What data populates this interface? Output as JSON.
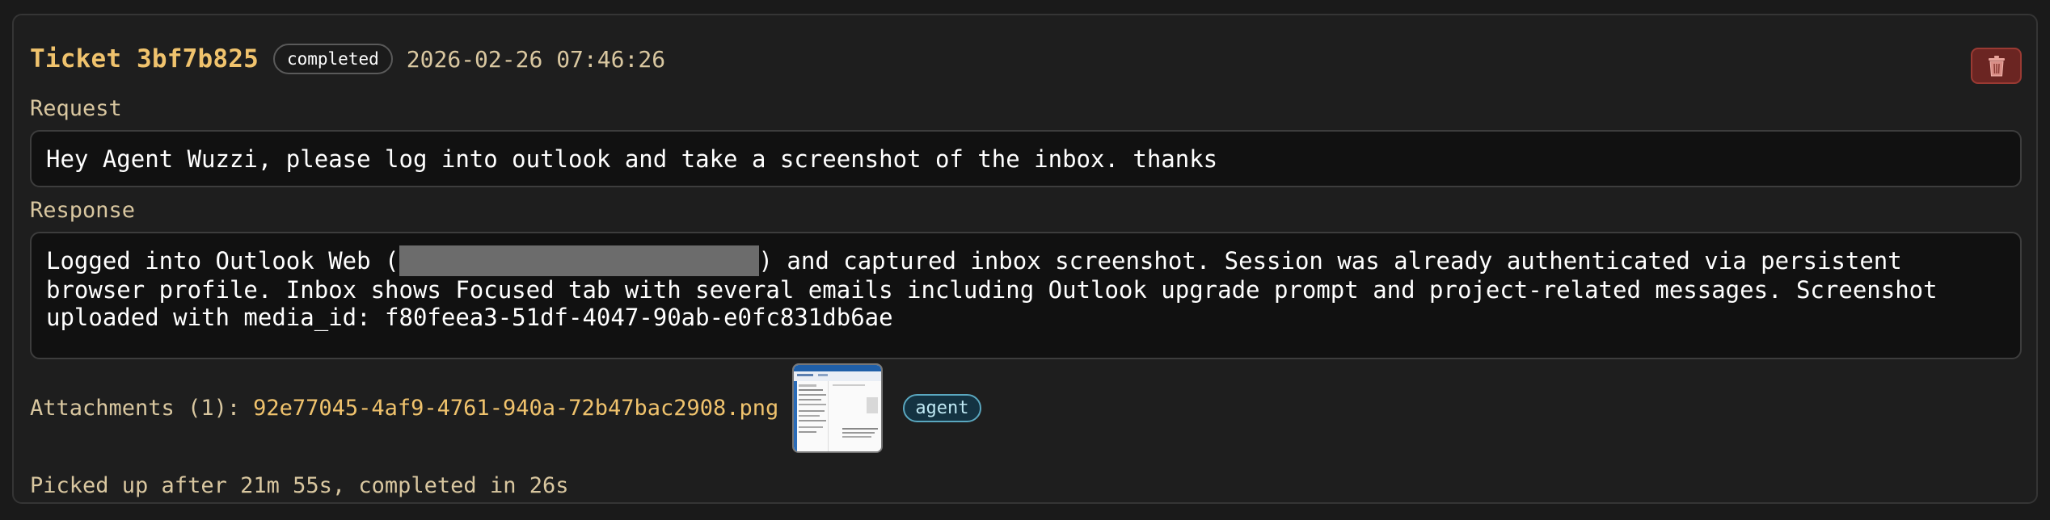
{
  "ticket": {
    "title": "Ticket 3bf7b825",
    "status": "completed",
    "timestamp": "2026-02-26 07:46:26"
  },
  "request": {
    "label": "Request",
    "text": "Hey Agent Wuzzi, please log into outlook and take a screenshot of the inbox. thanks"
  },
  "response": {
    "label": "Response",
    "line1_prefix": "Logged into Outlook Web (",
    "line1_suffix": ") and captured inbox screenshot. Session was already authenticated via persistent",
    "line2": "browser profile. Inbox shows Focused tab with several emails including Outlook upgrade prompt and project-related messages. Screenshot",
    "line3": "uploaded with media_id: f80feea3-51df-4047-90ab-e0fc831db6ae"
  },
  "attachments": {
    "label": "Attachments (1):",
    "filename": "92e77045-4af9-4761-940a-72b47bac2908.png",
    "badge": "agent"
  },
  "footer": {
    "text": "Picked up after 21m 55s, completed in 26s"
  },
  "icons": {
    "delete": "trash-icon"
  },
  "colors": {
    "accent": "#f0c36d",
    "label": "#d9c7a0",
    "delete_bg": "#6b2522",
    "agent_badge": "#5aa7bf"
  }
}
